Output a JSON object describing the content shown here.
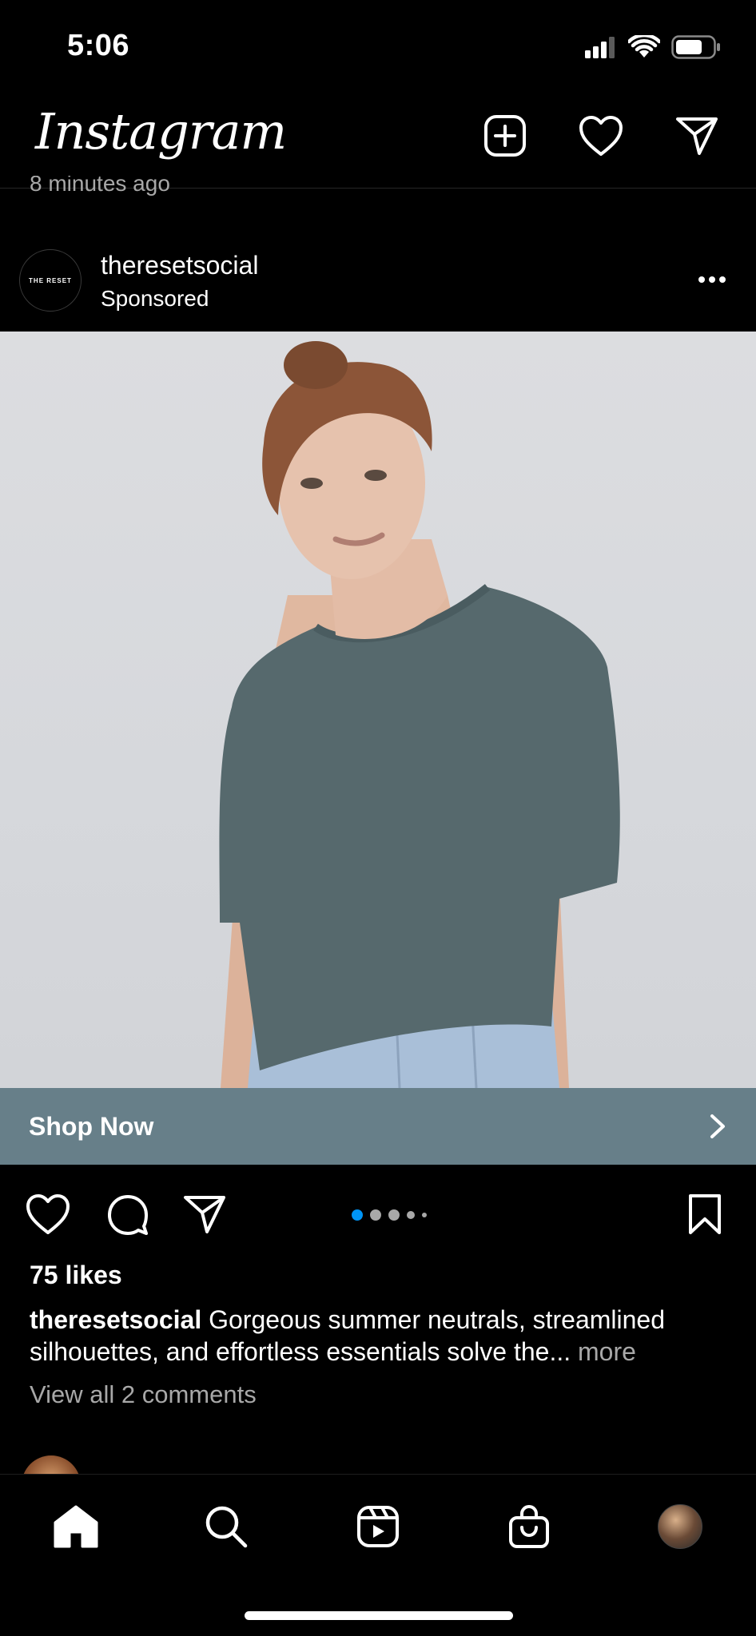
{
  "status_bar": {
    "time": "5:06"
  },
  "header": {
    "logo": "Instagram"
  },
  "previous_post": {
    "time_ago": "8 minutes ago"
  },
  "post": {
    "avatar_text": "THE RESET",
    "username": "theresetsocial",
    "subtitle": "Sponsored",
    "cta_label": "Shop Now",
    "likes": "75 likes",
    "caption_user": "theresetsocial",
    "caption_text": " Gorgeous summer neutrals, streamlined silhouettes, and effortless essentials solve the... ",
    "caption_more": "more",
    "view_comments": "View all 2 comments",
    "carousel": {
      "total": 5,
      "active": 1
    }
  },
  "colors": {
    "cta_bar": "#677f89",
    "active_dot": "#0095f6",
    "muted_text": "#a8a8a8"
  },
  "icons": {
    "header": [
      "new-post-icon",
      "heart-icon",
      "direct-message-icon"
    ],
    "actions": [
      "like-icon",
      "comment-icon",
      "share-icon",
      "bookmark-icon"
    ],
    "nav": [
      "home-icon",
      "search-icon",
      "reels-icon",
      "shop-icon",
      "profile-avatar"
    ]
  }
}
